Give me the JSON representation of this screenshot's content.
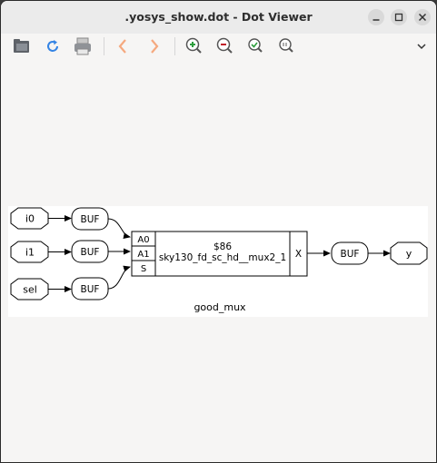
{
  "window": {
    "title": ".yosys_show.dot - Dot Viewer"
  },
  "toolbar": {
    "icons": [
      "open-icon",
      "reload-icon",
      "print-icon",
      "back-icon",
      "forward-icon",
      "zoom-in-icon",
      "zoom-out-icon",
      "zoom-fit-icon",
      "zoom-100-icon",
      "menu-chevron-icon"
    ]
  },
  "graph": {
    "inputs": [
      "i0",
      "i1",
      "sel"
    ],
    "buf_label": "BUF",
    "cell": {
      "ports_in": [
        "A0",
        "A1",
        "S"
      ],
      "id": "$86",
      "type": "sky130_fd_sc_hd__mux2_1",
      "port_out": "X"
    },
    "output": "y",
    "module_name": "good_mux"
  },
  "colors": {
    "accent_blue": "#3584e4",
    "zoom_in_green": "#2e9e3e",
    "zoom_out_red": "#c01c28",
    "nav_orange": "#f5a97f"
  }
}
